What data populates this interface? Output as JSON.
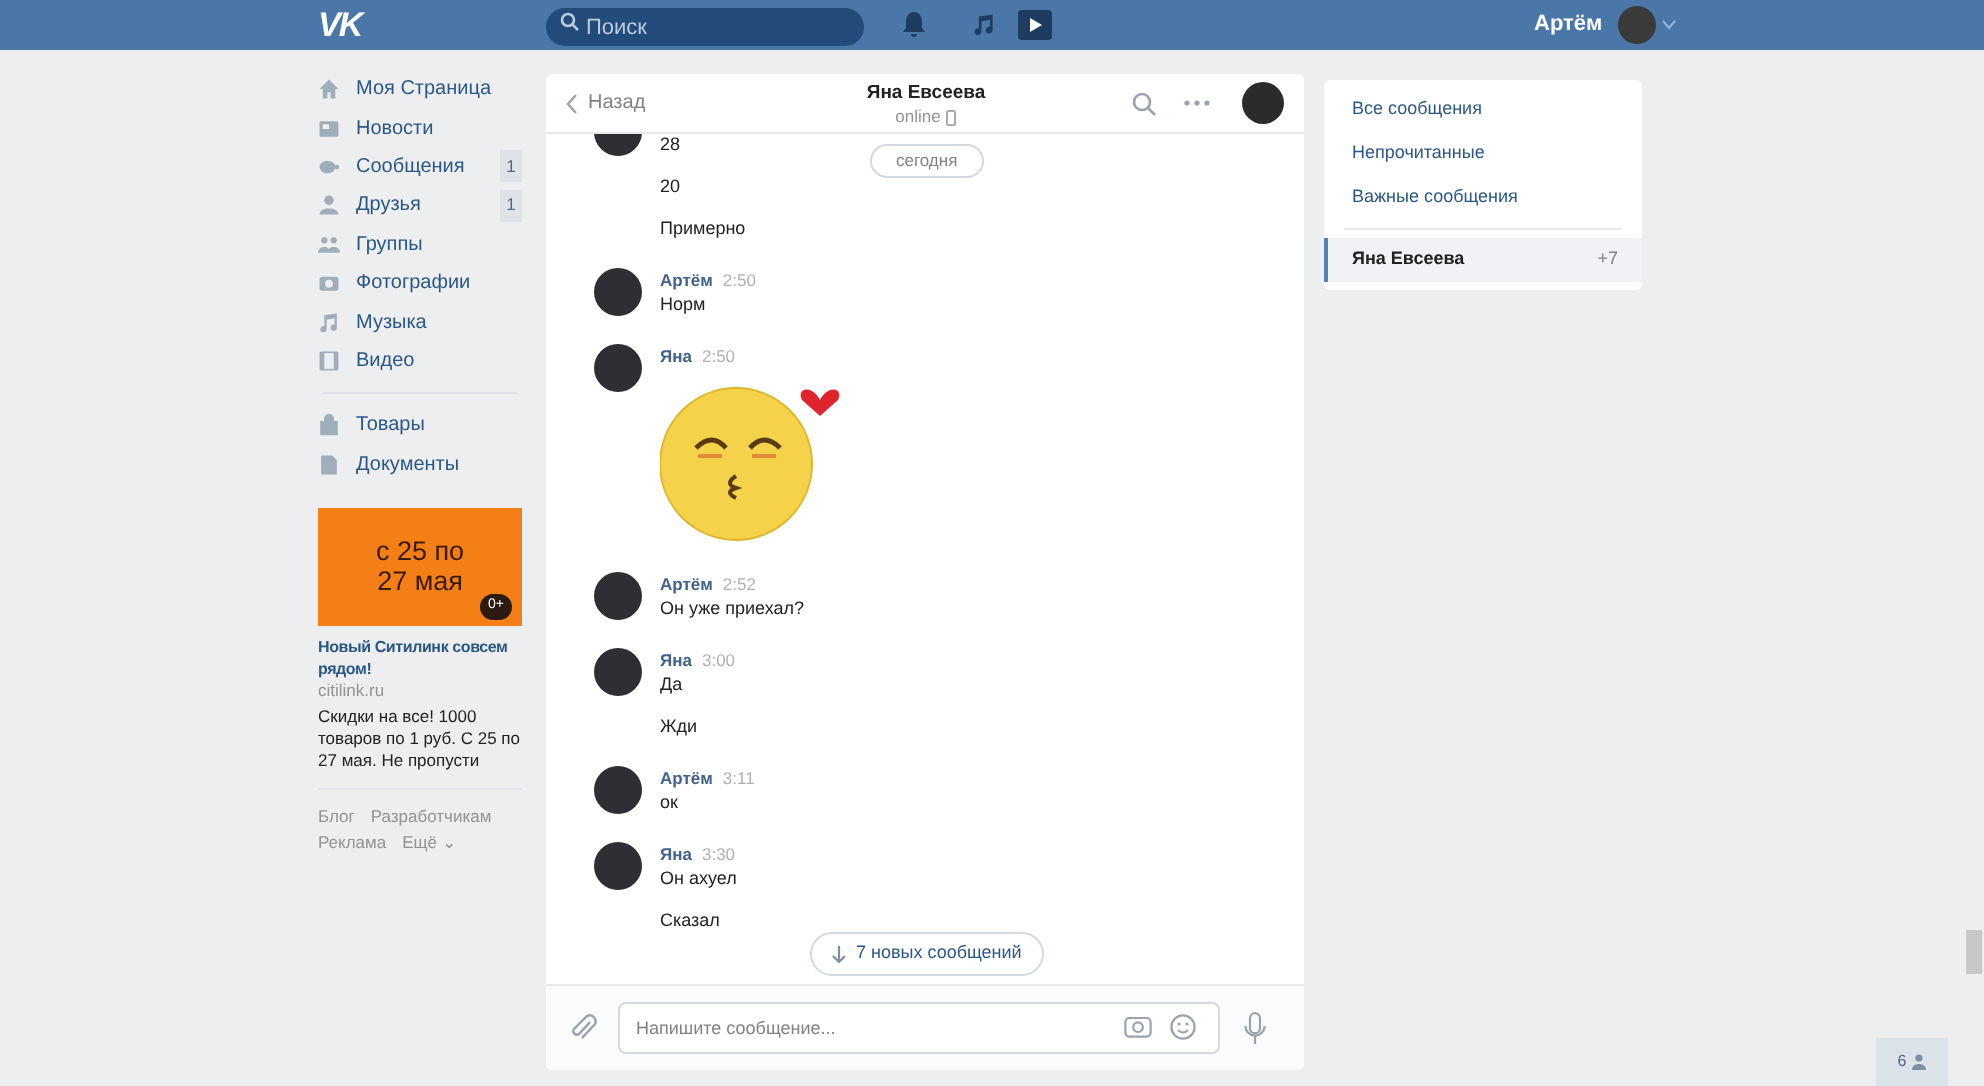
{
  "header": {
    "logo": "VK",
    "search": {
      "placeholder": "Поиск"
    },
    "user_name": "Артём"
  },
  "sidebar": {
    "items": [
      {
        "label": "Моя Страница"
      },
      {
        "label": "Новости"
      },
      {
        "label": "Сообщения",
        "count": "1"
      },
      {
        "label": "Друзья",
        "count": "1"
      },
      {
        "label": "Группы"
      },
      {
        "label": "Фотографии"
      },
      {
        "label": "Музыка"
      },
      {
        "label": "Видео"
      },
      {
        "label": "Товары"
      },
      {
        "label": "Документы"
      }
    ],
    "ad": {
      "banner_text": "с 25 по 27 мая",
      "age": "0+",
      "title": "Новый Ситилинк совсем рядом!",
      "domain": "citilink.ru",
      "text": "Скидки на все! 1000 товаров по 1 руб. С 25 по 27 мая. Не пропусти"
    },
    "footer_links": [
      "Блог",
      "Разработчикам",
      "Реклама",
      "Ещё ⌄"
    ]
  },
  "chat": {
    "back": "Назад",
    "title": "Яна Евсеева",
    "status": "online",
    "date_pill": "сегодня",
    "groups": [
      {
        "kind": "text",
        "lines": [
          "28",
          "20",
          "Примерно"
        ]
      },
      {
        "kind": "text",
        "author": "Артём",
        "time": "2:50",
        "lines": [
          "Норм"
        ]
      },
      {
        "kind": "sticker",
        "author": "Яна",
        "time": "2:50"
      },
      {
        "kind": "text",
        "author": "Артём",
        "time": "2:52",
        "lines": [
          "Он уже приехал?"
        ]
      },
      {
        "kind": "text",
        "author": "Яна",
        "time": "3:00",
        "lines": [
          "Да",
          "Жди"
        ]
      },
      {
        "kind": "text",
        "author": "Артём",
        "time": "3:11",
        "lines": [
          "ок"
        ]
      },
      {
        "kind": "text",
        "author": "Яна",
        "time": "3:30",
        "lines": [
          "Он ахуел",
          "Сказал"
        ]
      }
    ],
    "new_messages": "7 новых сообщений",
    "input": {
      "placeholder": "Напишите сообщение..."
    }
  },
  "filters": {
    "items": [
      {
        "label": "Все сообщения",
        "selected": false
      },
      {
        "label": "Непрочитанные",
        "selected": false
      },
      {
        "label": "Важные сообщения",
        "selected": false
      }
    ],
    "conversations": [
      {
        "name": "Яна Евсеева",
        "count": "+7",
        "selected": true
      }
    ]
  },
  "friends_online": {
    "count": "6"
  }
}
